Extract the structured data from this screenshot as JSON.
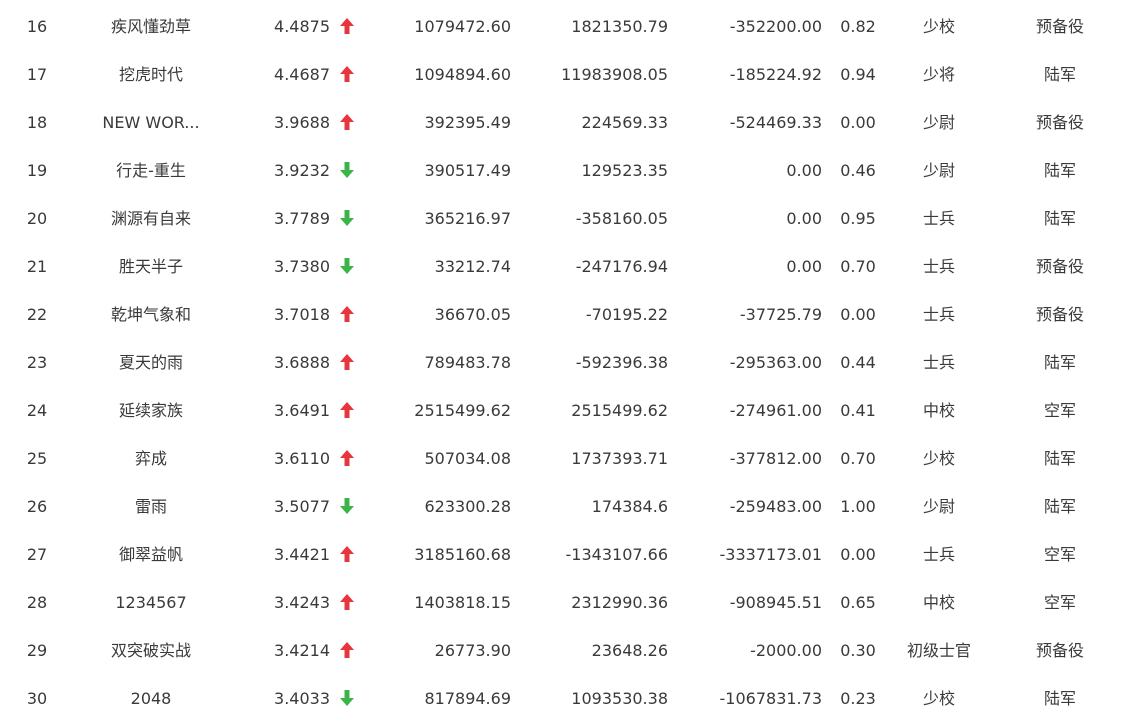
{
  "colors": {
    "up": "#e8343c",
    "down": "#3bb54a",
    "text": "#3a3a3a"
  },
  "rows": [
    {
      "rank": "16",
      "name": "疾风懂劲草",
      "score": "4.4875",
      "trend": "up",
      "v1": "1079472.60",
      "v2": "1821350.79",
      "v3": "-352200.00",
      "ratio": "0.82",
      "rank_title": "少校",
      "branch": "预备役"
    },
    {
      "rank": "17",
      "name": "挖虎时代",
      "score": "4.4687",
      "trend": "up",
      "v1": "1094894.60",
      "v2": "11983908.05",
      "v3": "-185224.92",
      "ratio": "0.94",
      "rank_title": "少将",
      "branch": "陆军"
    },
    {
      "rank": "18",
      "name": "NEW WOR...",
      "score": "3.9688",
      "trend": "up",
      "v1": "392395.49",
      "v2": "224569.33",
      "v3": "-524469.33",
      "ratio": "0.00",
      "rank_title": "少尉",
      "branch": "预备役"
    },
    {
      "rank": "19",
      "name": "行走-重生",
      "score": "3.9232",
      "trend": "down",
      "v1": "390517.49",
      "v2": "129523.35",
      "v3": "0.00",
      "ratio": "0.46",
      "rank_title": "少尉",
      "branch": "陆军"
    },
    {
      "rank": "20",
      "name": "渊源有自来",
      "score": "3.7789",
      "trend": "down",
      "v1": "365216.97",
      "v2": "-358160.05",
      "v3": "0.00",
      "ratio": "0.95",
      "rank_title": "士兵",
      "branch": "陆军"
    },
    {
      "rank": "21",
      "name": "胜天半子",
      "score": "3.7380",
      "trend": "down",
      "v1": "33212.74",
      "v2": "-247176.94",
      "v3": "0.00",
      "ratio": "0.70",
      "rank_title": "士兵",
      "branch": "预备役"
    },
    {
      "rank": "22",
      "name": "乾坤气象和",
      "score": "3.7018",
      "trend": "up",
      "v1": "36670.05",
      "v2": "-70195.22",
      "v3": "-37725.79",
      "ratio": "0.00",
      "rank_title": "士兵",
      "branch": "预备役"
    },
    {
      "rank": "23",
      "name": "夏天的雨",
      "score": "3.6888",
      "trend": "up",
      "v1": "789483.78",
      "v2": "-592396.38",
      "v3": "-295363.00",
      "ratio": "0.44",
      "rank_title": "士兵",
      "branch": "陆军"
    },
    {
      "rank": "24",
      "name": "延续家族",
      "score": "3.6491",
      "trend": "up",
      "v1": "2515499.62",
      "v2": "2515499.62",
      "v3": "-274961.00",
      "ratio": "0.41",
      "rank_title": "中校",
      "branch": "空军"
    },
    {
      "rank": "25",
      "name": "弈成",
      "score": "3.6110",
      "trend": "up",
      "v1": "507034.08",
      "v2": "1737393.71",
      "v3": "-377812.00",
      "ratio": "0.70",
      "rank_title": "少校",
      "branch": "陆军"
    },
    {
      "rank": "26",
      "name": "雷雨",
      "score": "3.5077",
      "trend": "down",
      "v1": "623300.28",
      "v2": "174384.6",
      "v3": "-259483.00",
      "ratio": "1.00",
      "rank_title": "少尉",
      "branch": "陆军"
    },
    {
      "rank": "27",
      "name": "御翠益帆",
      "score": "3.4421",
      "trend": "up",
      "v1": "3185160.68",
      "v2": "-1343107.66",
      "v3": "-3337173.01",
      "ratio": "0.00",
      "rank_title": "士兵",
      "branch": "空军"
    },
    {
      "rank": "28",
      "name": "1234567",
      "score": "3.4243",
      "trend": "up",
      "v1": "1403818.15",
      "v2": "2312990.36",
      "v3": "-908945.51",
      "ratio": "0.65",
      "rank_title": "中校",
      "branch": "空军"
    },
    {
      "rank": "29",
      "name": "双突破实战",
      "score": "3.4214",
      "trend": "up",
      "v1": "26773.90",
      "v2": "23648.26",
      "v3": "-2000.00",
      "ratio": "0.30",
      "rank_title": "初级士官",
      "branch": "预备役"
    },
    {
      "rank": "30",
      "name": "2048",
      "score": "3.4033",
      "trend": "down",
      "v1": "817894.69",
      "v2": "1093530.38",
      "v3": "-1067831.73",
      "ratio": "0.23",
      "rank_title": "少校",
      "branch": "陆军"
    }
  ]
}
